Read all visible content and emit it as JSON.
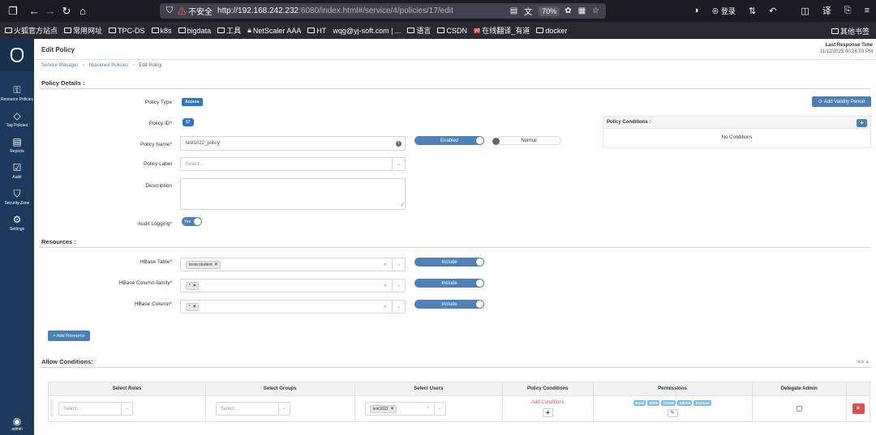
{
  "browser": {
    "url_security": "不安全",
    "url_host": "http://192.168.242.232",
    "url_rest": ":6080/index.html#/service/4/policies/17/edit",
    "zoom": "70%",
    "login_label": "登录",
    "bookmarks": [
      "火狐官方站点",
      "常用网址",
      "TPC-DS",
      "k8s",
      "bigdata",
      "工具",
      "NetScaler AAA",
      "HT",
      "wqg@yj-soft.com | ...",
      "语言",
      "CSDN",
      "在线翻译_有道",
      "docker"
    ],
    "other_bookmarks": "其他书签"
  },
  "sidebar": {
    "items": [
      {
        "icon": "key-icon",
        "label": "Resource Policies"
      },
      {
        "icon": "tag-icon",
        "label": "Tag Policies"
      },
      {
        "icon": "reports-icon",
        "label": "Reports"
      },
      {
        "icon": "audit-icon",
        "label": "Audit"
      },
      {
        "icon": "security-zone-icon",
        "label": "Security Zone"
      },
      {
        "icon": "settings-icon",
        "label": "Settings"
      }
    ],
    "user_label": "admin"
  },
  "header": {
    "title": "Edit Policy",
    "last_response_label": "Last Response Time",
    "last_response_time": "11/12/2025 00:26:03 PM"
  },
  "breadcrumb": {
    "items": [
      "Service Manager",
      "hbasetest Policies",
      "Edit Policy"
    ]
  },
  "policy_details": {
    "section_title": "Policy Details :",
    "type_label": "Policy Type",
    "type_value": "Access",
    "id_label": "Policy ID*",
    "id_value": "17",
    "name_label": "Policy Name*",
    "name_value": "test1022_policy",
    "enabled_label": "Enabled",
    "normal_label": "Normal",
    "label_label": "Policy Label",
    "label_placeholder": "Select...",
    "description_label": "Description",
    "audit_label": "Audit Logging*",
    "audit_value": "Yes",
    "validity_button": "Add Validity Period",
    "conditions_title": "Policy Conditions :",
    "no_conditions": "No Conditions"
  },
  "resources": {
    "section_title": "Resources :",
    "rows": [
      {
        "label": "HBase Table*",
        "tag": "testa:student",
        "toggle": "Include"
      },
      {
        "label": "HBase Column-family*",
        "tag": "*",
        "toggle": "Include"
      },
      {
        "label": "HBase Column*",
        "tag": "*",
        "toggle": "Include"
      }
    ],
    "add_button": "+ Add Resource"
  },
  "allow_conditions": {
    "section_title": "Allow Conditions:",
    "hide_link": "hide ▲",
    "columns": [
      "Select Roles",
      "Select Groups",
      "Select Users",
      "Policy Conditions",
      "Permissions",
      "Delegate Admin"
    ],
    "row": {
      "roles_placeholder": "Select...",
      "groups_placeholder": "Select...",
      "user_tag": "test1022",
      "add_conditions": "Add Conditions",
      "permissions": [
        "Read",
        "Write",
        "Create",
        "Admin",
        "Execute"
      ]
    }
  }
}
